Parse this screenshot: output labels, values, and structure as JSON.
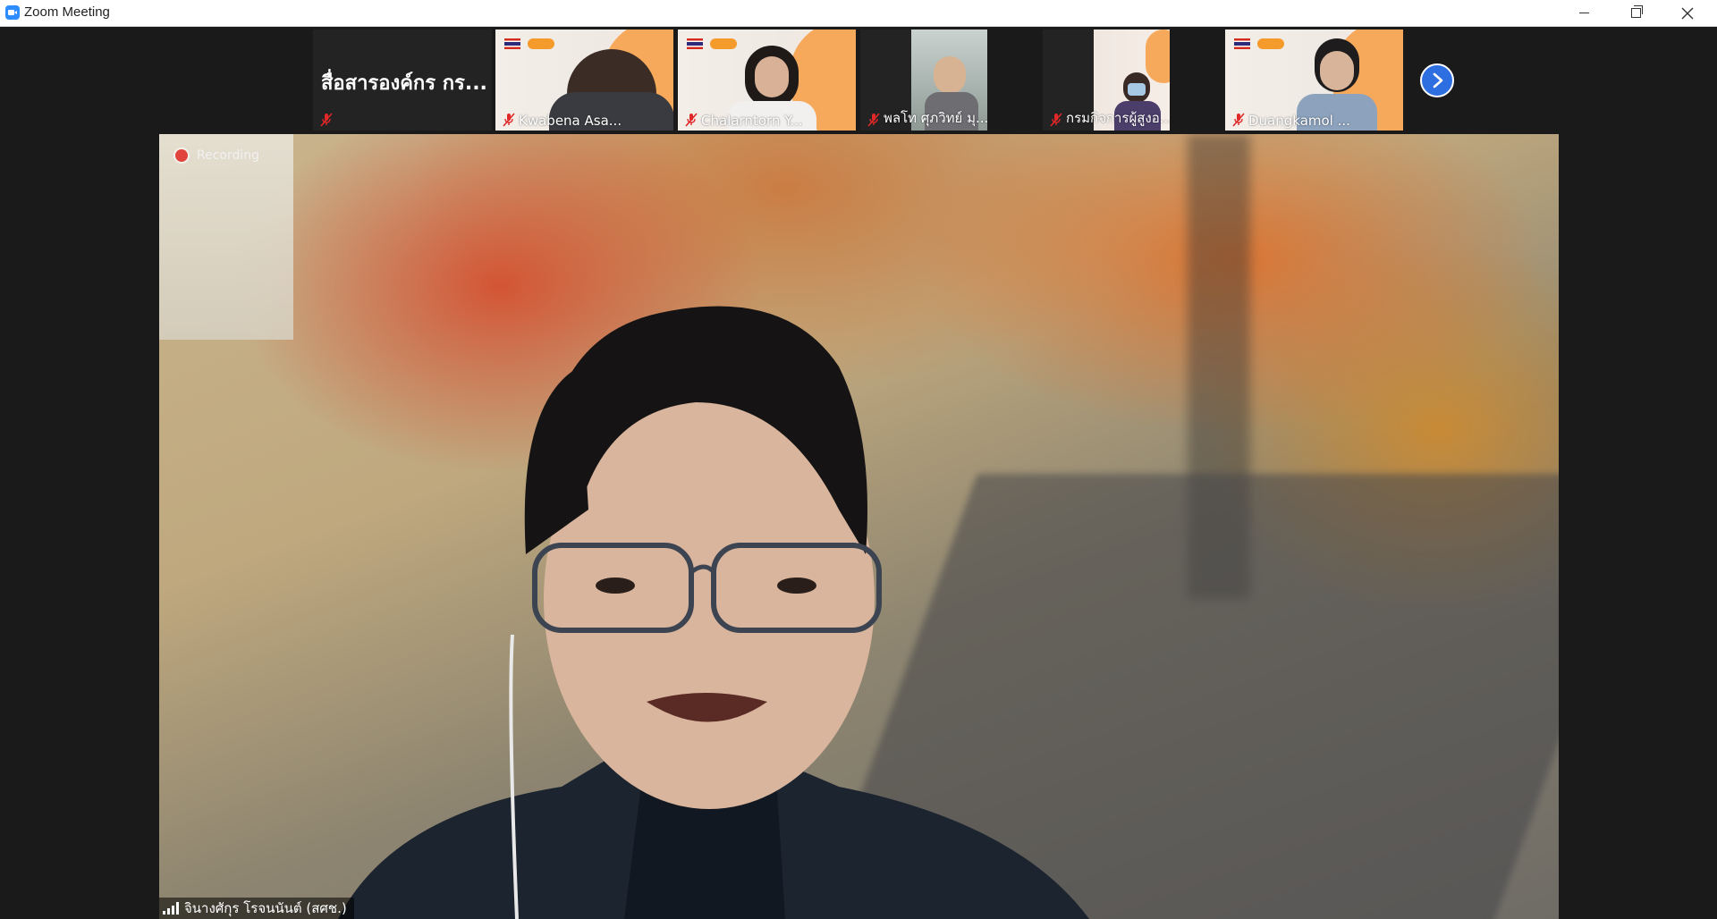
{
  "window": {
    "title": "Zoom Meeting"
  },
  "gallery": {
    "tiles": [
      {
        "name": "สื่อสารองค์กร กร...",
        "kind": "name-only",
        "muted": true
      },
      {
        "name": "Kwabena Asa...",
        "kind": "video",
        "muted": true
      },
      {
        "name": "Chalarntorn Y...",
        "kind": "video",
        "muted": true
      },
      {
        "name": "พลโท ศุภวิทย์ มุ...",
        "kind": "video",
        "muted": true
      },
      {
        "name": "กรมกิจการผู้สูงอ...",
        "kind": "video",
        "muted": true
      },
      {
        "name": "Duangkamol ...",
        "kind": "video",
        "muted": true
      }
    ],
    "next_icon": "chevron-right-icon"
  },
  "main": {
    "recording_label": "Recording",
    "speaker_name": "จินางศักุร โรจนนันต์ (สศช.)"
  },
  "colors": {
    "accent": "#2d8cff",
    "next_button": "#2d6fe0",
    "recording": "#e0443c",
    "mute": "#e02828"
  }
}
